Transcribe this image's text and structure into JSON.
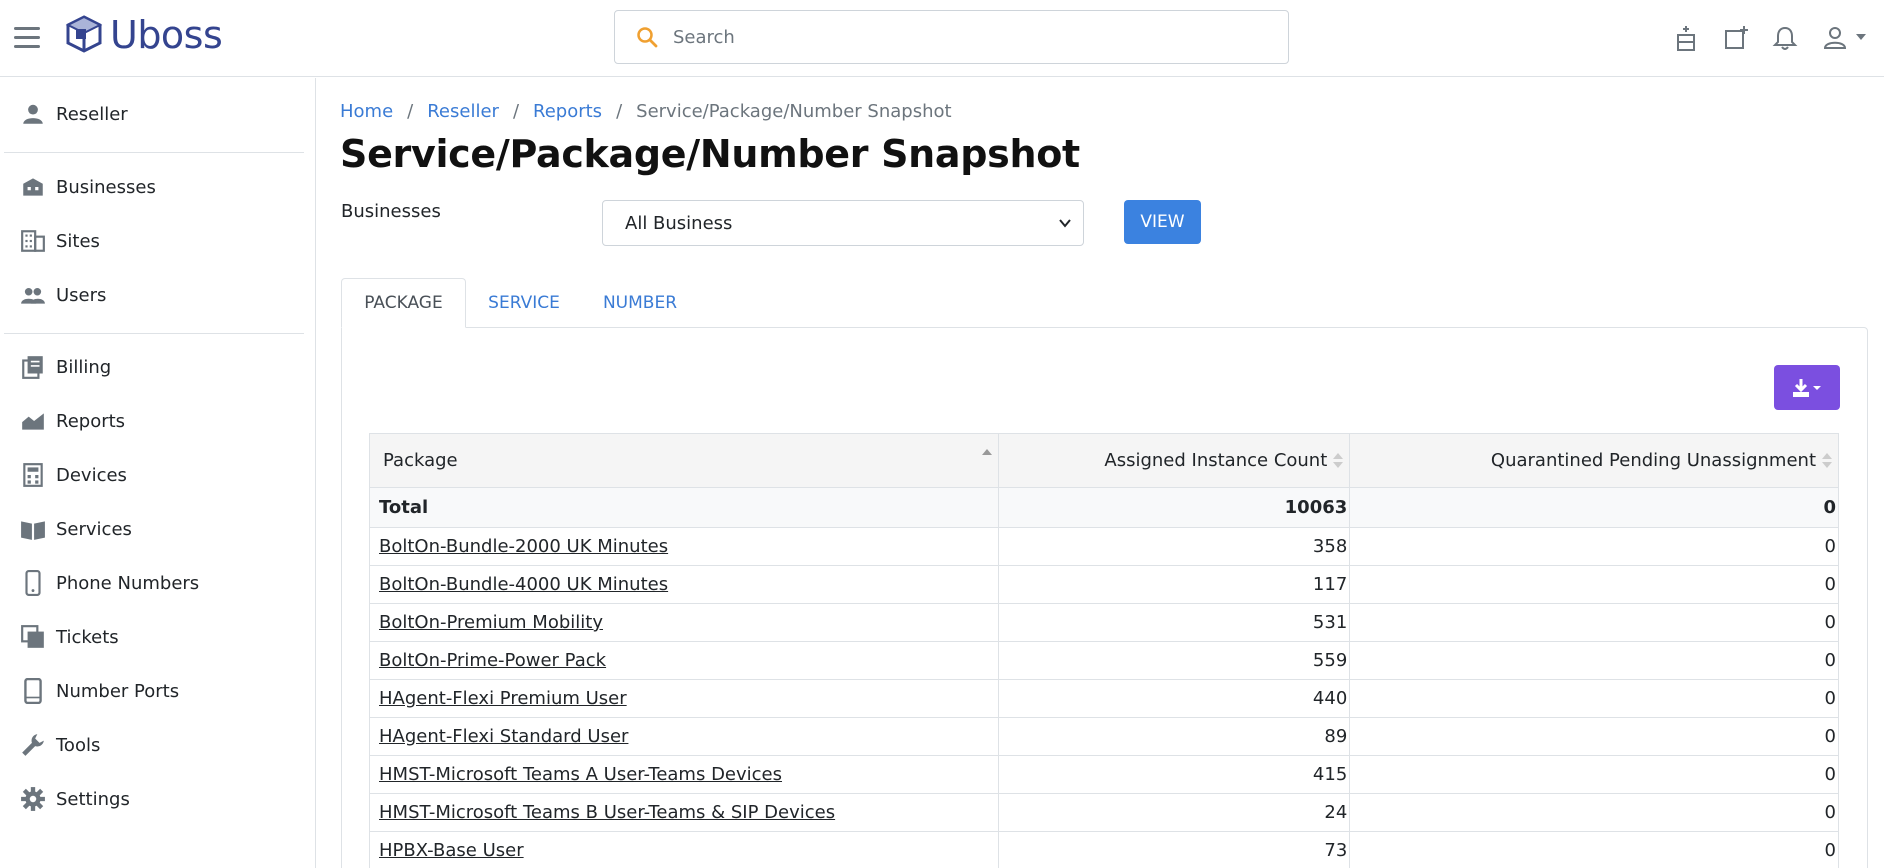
{
  "header": {
    "brand": "Uboss",
    "search_placeholder": "Search"
  },
  "sidebar": {
    "items": [
      {
        "label": "Reseller",
        "icon": "person-icon"
      },
      {
        "label": "Businesses",
        "icon": "building-icon"
      },
      {
        "label": "Sites",
        "icon": "office-building-icon"
      },
      {
        "label": "Users",
        "icon": "group-icon"
      },
      {
        "label": "Billing",
        "icon": "billing-icon"
      },
      {
        "label": "Reports",
        "icon": "chart-icon"
      },
      {
        "label": "Devices",
        "icon": "calculator-icon"
      },
      {
        "label": "Services",
        "icon": "book-icon"
      },
      {
        "label": "Phone Numbers",
        "icon": "phone-icon"
      },
      {
        "label": "Tickets",
        "icon": "tickets-icon"
      },
      {
        "label": "Number Ports",
        "icon": "mobile-icon"
      },
      {
        "label": "Tools",
        "icon": "wrench-icon"
      },
      {
        "label": "Settings",
        "icon": "gear-icon"
      }
    ]
  },
  "breadcrumb": {
    "items": [
      "Home",
      "Reseller",
      "Reports"
    ],
    "current": "Service/Package/Number Snapshot",
    "separator": "/"
  },
  "page": {
    "title": "Service/Package/Number Snapshot",
    "filter_label": "Businesses",
    "filter_value": "All Business",
    "view_button": "VIEW"
  },
  "tabs": [
    {
      "label": "PACKAGE",
      "active": true
    },
    {
      "label": "SERVICE",
      "active": false
    },
    {
      "label": "NUMBER",
      "active": false
    }
  ],
  "table": {
    "columns": [
      "Package",
      "Assigned Instance Count",
      "Quarantined Pending Unassignment"
    ],
    "total": {
      "label": "Total",
      "assigned": "10063",
      "quarantined": "0"
    },
    "rows": [
      {
        "package": "BoltOn-Bundle-2000 UK Minutes",
        "assigned": "358",
        "quarantined": "0"
      },
      {
        "package": "BoltOn-Bundle-4000 UK Minutes",
        "assigned": "117",
        "quarantined": "0"
      },
      {
        "package": "BoltOn-Premium Mobility",
        "assigned": "531",
        "quarantined": "0"
      },
      {
        "package": "BoltOn-Prime-Power Pack",
        "assigned": "559",
        "quarantined": "0"
      },
      {
        "package": "HAgent-Flexi Premium User",
        "assigned": "440",
        "quarantined": "0"
      },
      {
        "package": "HAgent-Flexi Standard User",
        "assigned": "89",
        "quarantined": "0"
      },
      {
        "package": "HMST-Microsoft Teams A User-Teams Devices",
        "assigned": "415",
        "quarantined": "0"
      },
      {
        "package": "HMST-Microsoft Teams B User-Teams & SIP Devices",
        "assigned": "24",
        "quarantined": "0"
      },
      {
        "package": "HPBX-Base User",
        "assigned": "73",
        "quarantined": "0"
      }
    ]
  },
  "colors": {
    "link": "#3a7bd5",
    "view_button": "#3b82e0",
    "export_button": "#7b4fe0",
    "search_icon": "#f0a030",
    "brand": "#34448f"
  }
}
